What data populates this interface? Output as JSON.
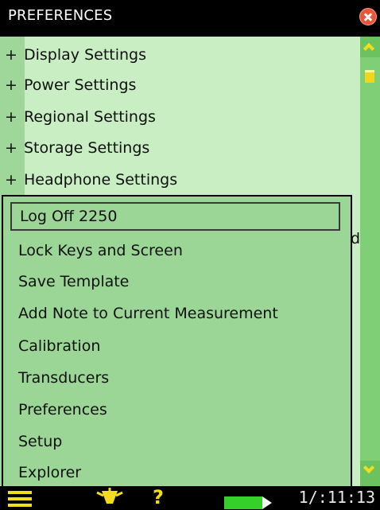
{
  "window": {
    "title": "PREFERENCES"
  },
  "tree": {
    "expand_symbol": "+",
    "items": [
      {
        "label": "Display Settings"
      },
      {
        "label": "Power Settings"
      },
      {
        "label": "Regional Settings"
      },
      {
        "label": "Storage Settings"
      },
      {
        "label": "Headphone Settings"
      }
    ],
    "partial_text": "d"
  },
  "menu": {
    "selected_index": 0,
    "items": [
      {
        "label": "Log Off 2250"
      },
      {
        "label": "Lock Keys and Screen"
      },
      {
        "label": "Save Template"
      },
      {
        "label": "Add Note to Current Measurement"
      },
      {
        "label": "Calibration"
      },
      {
        "label": "Transducers"
      },
      {
        "label": "Preferences"
      },
      {
        "label": "Setup"
      },
      {
        "label": "Explorer"
      }
    ]
  },
  "statusbar": {
    "help_symbol": "?",
    "clock": "1/:11:13"
  },
  "colors": {
    "list_bg": "#c9eec3",
    "menu_bg": "#9bd696",
    "accent_yellow": "#f2dd1d",
    "close_red": "#e8553a",
    "battery_green": "#35d12a"
  },
  "icons": [
    "close-icon",
    "scroll-up-icon",
    "scroll-down-icon",
    "main-menu-icon",
    "backlight-icon",
    "help-icon",
    "battery-icon"
  ]
}
